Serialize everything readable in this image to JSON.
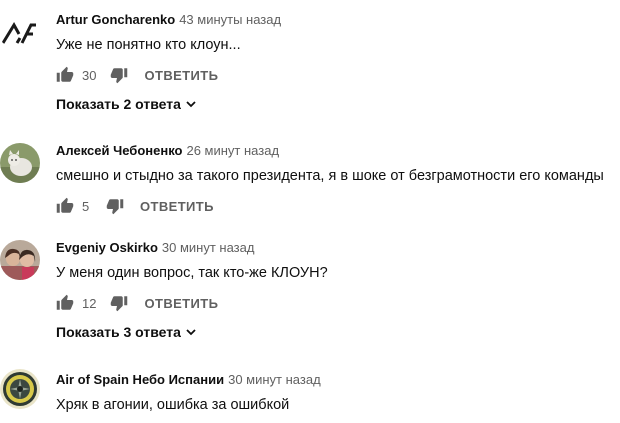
{
  "comments": [
    {
      "author": "Artur Goncharenko",
      "time": "43 минуты назад",
      "text": "Уже не понятно кто клоун...",
      "likes": "30",
      "reply_label": "ОТВЕТИТЬ",
      "replies_label": "Показать 2 ответа",
      "avatar_icon": "af-logo-icon"
    },
    {
      "author": "Алексей Чебоненко",
      "time": "26 минут назад",
      "text": "смешно и стыдно за такого президента, я в шоке от безграмотности его команды",
      "likes": "5",
      "reply_label": "ОТВЕТИТЬ",
      "avatar_icon": "cat-photo-icon"
    },
    {
      "author": "Evgeniy Oskirko",
      "time": "30 минут назад",
      "text": "У  меня один вопрос, так кто-же КЛОУН?",
      "likes": "12",
      "reply_label": "ОТВЕТИТЬ",
      "replies_label": "Показать 3 ответа",
      "avatar_icon": "couple-photo-icon"
    },
    {
      "author": "Air of Spain Небо Испании",
      "time": "30 минут назад",
      "text": "Хряк в агонии, ошибка за ошибкой",
      "avatar_icon": "aircraft-engine-icon"
    }
  ],
  "colors": {
    "text_primary": "#0f0f0f",
    "text_secondary": "#606060",
    "icon_gray": "#606060"
  }
}
